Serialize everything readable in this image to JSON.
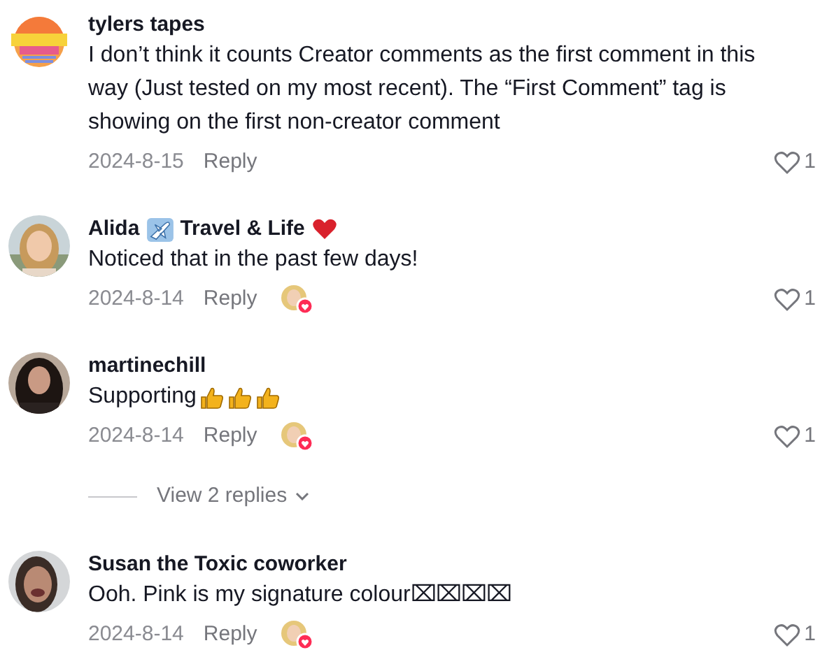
{
  "comments": [
    {
      "name": [
        {
          "kind": "text",
          "text": "tylers tapes"
        }
      ],
      "body": [
        {
          "kind": "text",
          "text": "I don’t think it counts Creator comments as the first comment in this way (Just tested on my most recent). The “First Comment” tag is showing on the first non-creator comment"
        }
      ],
      "date": "2024-8-15",
      "reply": "Reply",
      "creator_liked": false,
      "likes": "1"
    },
    {
      "name": [
        {
          "kind": "text",
          "text": "Alida"
        },
        {
          "kind": "plane"
        },
        {
          "kind": "text",
          "text": "Travel & Life"
        },
        {
          "kind": "heart"
        }
      ],
      "body": [
        {
          "kind": "text",
          "text": "Noticed that in the past few days!"
        }
      ],
      "date": "2024-8-14",
      "reply": "Reply",
      "creator_liked": true,
      "likes": "1"
    },
    {
      "name": [
        {
          "kind": "text",
          "text": "martinechill"
        }
      ],
      "body": [
        {
          "kind": "text",
          "text": "Supporting"
        },
        {
          "kind": "thumbs-up"
        },
        {
          "kind": "thumbs-up"
        },
        {
          "kind": "thumbs-up"
        }
      ],
      "date": "2024-8-14",
      "reply": "Reply",
      "creator_liked": true,
      "likes": "1",
      "replies": "View 2 replies"
    },
    {
      "name": [
        {
          "kind": "text",
          "text": "Susan the Toxic coworker"
        }
      ],
      "body": [
        {
          "kind": "text",
          "text": "Ooh. Pink is my signature colour⌧⌧⌧⌧"
        }
      ],
      "date": "2024-8-14",
      "reply": "Reply",
      "creator_liked": true,
      "likes": "1"
    }
  ]
}
